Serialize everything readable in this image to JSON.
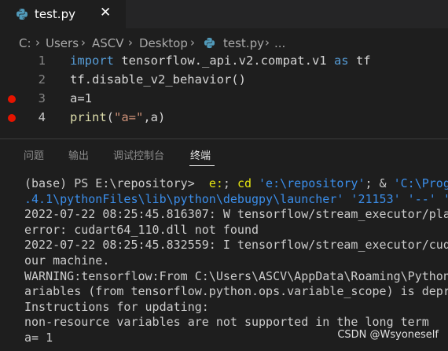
{
  "tab": {
    "title": "test.py",
    "close": "✕",
    "icon": "python-file-icon"
  },
  "breadcrumb": [
    "C:",
    "Users",
    "ASCV",
    "Desktop",
    "test.py",
    "..."
  ],
  "editor": {
    "lines": [
      {
        "number": "1",
        "parts": [
          [
            "kw",
            "import"
          ],
          [
            "",
            " tensorflow._api.v2.compat.v1 "
          ],
          [
            "kw",
            "as"
          ],
          [
            "",
            " tf"
          ]
        ],
        "breakpoint": false
      },
      {
        "number": "2",
        "parts": [
          [
            "",
            "tf.disable_v2_behavior()"
          ]
        ],
        "breakpoint": false
      },
      {
        "number": "3",
        "parts": [
          [
            "",
            "a=1"
          ]
        ],
        "breakpoint": true
      },
      {
        "number": "4",
        "parts": [
          [
            "fn",
            "print"
          ],
          [
            "",
            "("
          ],
          [
            "str",
            "\"a=\""
          ],
          [
            "",
            ",a)"
          ]
        ],
        "breakpoint": true
      }
    ]
  },
  "panel": {
    "tabs": [
      "问题",
      "输出",
      "调试控制台",
      "终端"
    ],
    "active": "终端"
  },
  "terminal": {
    "lines": [
      [
        [
          "",
          "(base) PS E:\\repository>  "
        ],
        [
          "cmd",
          "e:"
        ],
        [
          "",
          "; "
        ],
        [
          "cmd",
          "cd"
        ],
        [
          "",
          " "
        ],
        [
          "tstr",
          "'e:\\repository'"
        ],
        [
          "",
          "; & "
        ],
        [
          "tstr",
          "'C:\\Prog"
        ]
      ],
      [
        [
          "tstr",
          ".4.1\\pythonFiles\\lib\\python\\debugpy\\launcher'"
        ],
        [
          "",
          " "
        ],
        [
          "tstr",
          "'21153'"
        ],
        [
          "",
          " "
        ],
        [
          "tstr",
          "'--'"
        ],
        [
          "",
          " "
        ],
        [
          "tstr",
          "'"
        ]
      ],
      [
        [
          "",
          "2022-07-22 08:25:45.816307: W tensorflow/stream_executor/pla"
        ]
      ],
      [
        [
          "",
          "error: cudart64_110.dll not found"
        ]
      ],
      [
        [
          "",
          "2022-07-22 08:25:45.832559: I tensorflow/stream_executor/cud"
        ]
      ],
      [
        [
          "",
          "our machine."
        ]
      ],
      [
        [
          "",
          "WARNING:tensorflow:From C:\\Users\\ASCV\\AppData\\Roaming\\Python"
        ]
      ],
      [
        [
          "",
          "ariables (from tensorflow.python.ops.variable_scope) is depr"
        ]
      ],
      [
        [
          "",
          "Instructions for updating:"
        ]
      ],
      [
        [
          "",
          "non-resource variables are not supported in the long term"
        ]
      ],
      [
        [
          "",
          "a= 1"
        ]
      ]
    ]
  },
  "watermark": "CSDN @Wsyoneself"
}
